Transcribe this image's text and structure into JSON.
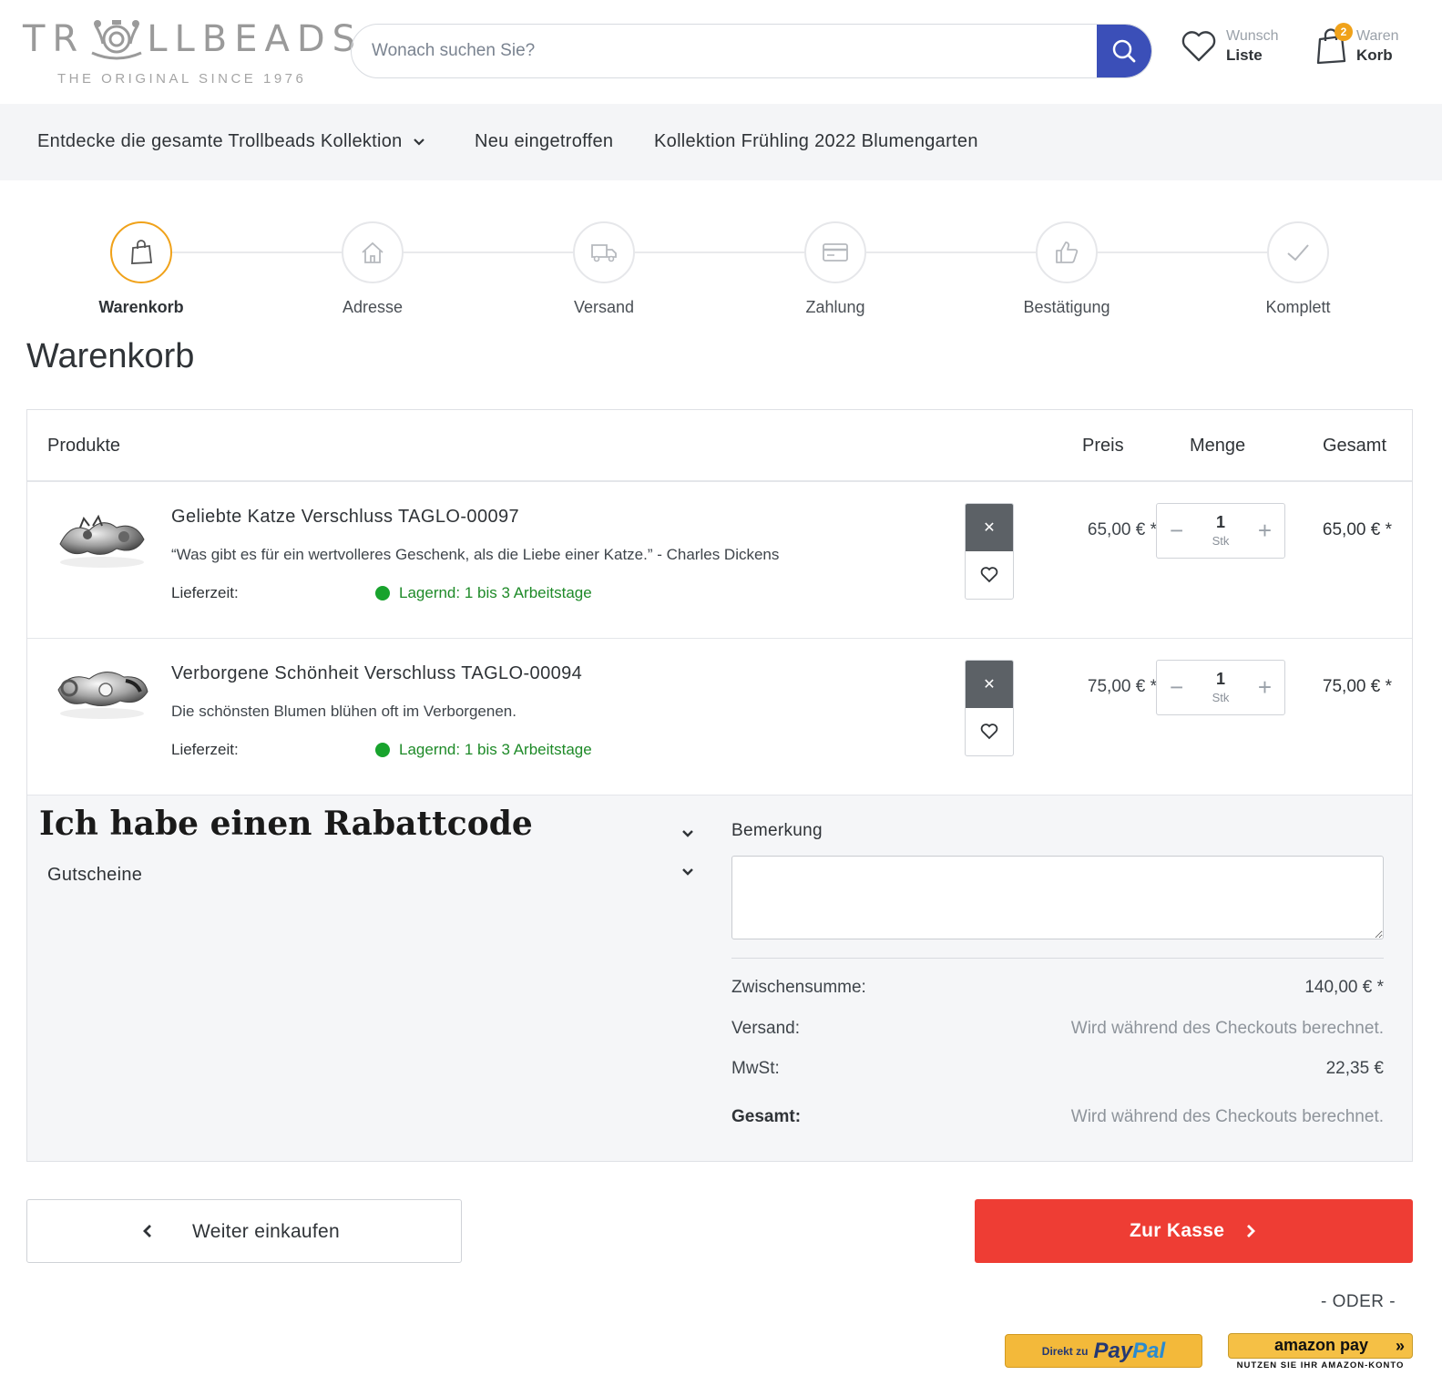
{
  "brand": {
    "logo_word_left": "TR",
    "logo_word_right": "LLBEADS",
    "tagline": "THE ORIGINAL SINCE 1976"
  },
  "search": {
    "placeholder": "Wonach suchen Sie?"
  },
  "header": {
    "wishlist_line1": "Wunsch",
    "wishlist_line2": "Liste",
    "cart_line1": "Waren",
    "cart_line2": "Korb",
    "cart_count": "2"
  },
  "nav": {
    "items": [
      {
        "label": "Entdecke die gesamte Trollbeads Kollektion"
      },
      {
        "label": "Neu eingetroffen"
      },
      {
        "label": "Kollektion Frühling 2022 Blumengarten"
      }
    ]
  },
  "steps": [
    {
      "label": "Warenkorb",
      "icon": "shopping-bag-icon",
      "active": true
    },
    {
      "label": "Adresse",
      "icon": "home-icon",
      "active": false
    },
    {
      "label": "Versand",
      "icon": "truck-icon",
      "active": false
    },
    {
      "label": "Zahlung",
      "icon": "credit-card-icon",
      "active": false
    },
    {
      "label": "Bestätigung",
      "icon": "thumbs-up-icon",
      "active": false
    },
    {
      "label": "Komplett",
      "icon": "checkmark-icon",
      "active": false
    }
  ],
  "page_title": "Warenkorb",
  "table": {
    "headers": {
      "products": "Produkte",
      "price": "Preis",
      "quantity": "Menge",
      "total": "Gesamt"
    },
    "rows": [
      {
        "name": "Geliebte Katze Verschluss TAGLO-00097",
        "description": "“Was gibt es für ein wertvolleres Geschenk, als die Liebe einer Katze.” - Charles Dickens",
        "delivery_label": "Lieferzeit:",
        "stock": "Lagernd: 1 bis 3 Arbeitstage",
        "price": "65,00 € *",
        "qty": "1",
        "unit": "Stk",
        "total": "65,00 € *"
      },
      {
        "name": "Verborgene Schönheit Verschluss TAGLO-00094",
        "description": "Die schönsten Blumen blühen oft im Verborgenen.",
        "delivery_label": "Lieferzeit:",
        "stock": "Lagernd: 1 bis 3 Arbeitstage",
        "price": "75,00 € *",
        "qty": "1",
        "unit": "Stk",
        "total": "75,00 € *"
      }
    ]
  },
  "coupon": {
    "title": "Ich habe einen Rabattcode",
    "vouchers_label": "Gutscheine"
  },
  "remark": {
    "label": "Bemerkung",
    "value": ""
  },
  "summary": {
    "subtotal_label": "Zwischensumme:",
    "subtotal_value": "140,00 € *",
    "shipping_label": "Versand:",
    "shipping_value": "Wird während des Checkouts berechnet.",
    "tax_label": "MwSt:",
    "tax_value": "22,35 €",
    "total_label": "Gesamt:",
    "total_value": "Wird während des Checkouts berechnet."
  },
  "actions": {
    "continue_label": "Weiter einkaufen",
    "checkout_label": "Zur Kasse",
    "or_label": "- ODER -",
    "paypal_prefix": "Direkt zu",
    "paypal_brand_1": "Pay",
    "paypal_brand_2": "Pal",
    "amazon_label": "amazon pay",
    "amazon_sub": "NUTZEN SIE IHR AMAZON-KONTO"
  },
  "colors": {
    "accent": "#f0a21a",
    "search_button": "#3b4fb8",
    "checkout": "#ee3d34",
    "stock_green": "#18a32d"
  }
}
